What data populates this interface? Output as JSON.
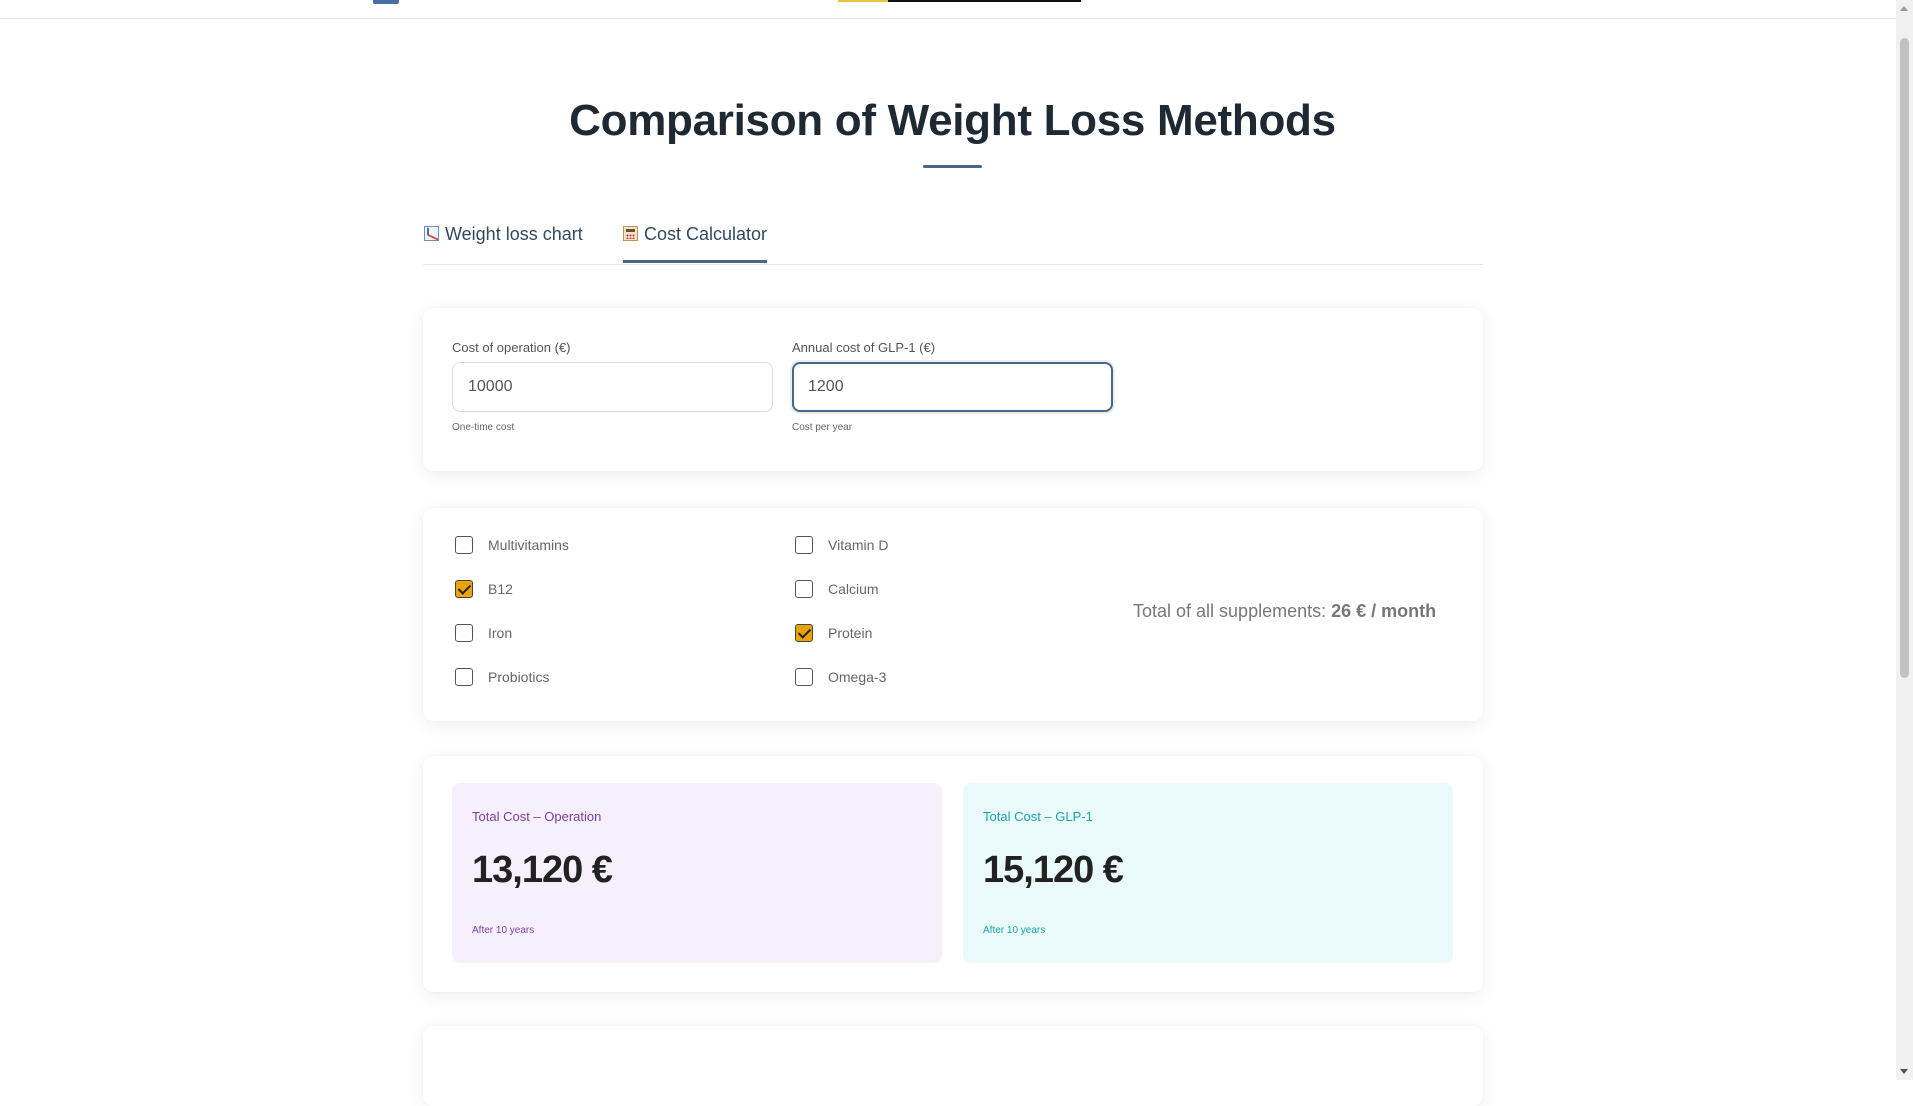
{
  "page": {
    "title": "Comparison of Weight Loss Methods"
  },
  "tabs": [
    {
      "label": "Weight loss chart",
      "icon": "chart-decreasing-icon",
      "active": false
    },
    {
      "label": "Cost Calculator",
      "icon": "abacus-icon",
      "active": true
    }
  ],
  "inputs": {
    "operation": {
      "label": "Cost of operation (€)",
      "value": "10000",
      "hint": "One-time cost"
    },
    "glp1": {
      "label": "Annual cost of GLP-1 (€)",
      "value": "1200",
      "hint": "Cost per year"
    }
  },
  "supplements": {
    "items": [
      {
        "label": "Multivitamins",
        "checked": false
      },
      {
        "label": "B12",
        "checked": true
      },
      {
        "label": "Iron",
        "checked": false
      },
      {
        "label": "Probiotics",
        "checked": false
      },
      {
        "label": "Vitamin D",
        "checked": false
      },
      {
        "label": "Calcium",
        "checked": false
      },
      {
        "label": "Protein",
        "checked": true
      },
      {
        "label": "Omega-3",
        "checked": false
      }
    ],
    "total_label": "Total of all supplements:",
    "total_value": "26 € / month"
  },
  "results": {
    "operation": {
      "label": "Total Cost – Operation",
      "value": "13,120 €",
      "note": "After 10 years"
    },
    "glp1": {
      "label": "Total Cost – GLP-1",
      "value": "15,120 €",
      "note": "After 10 years"
    }
  },
  "colors": {
    "accent": "#4a6782",
    "checkbox_checked": "#e9a400",
    "operation_accent": "#7a3e9d",
    "glp1_accent": "#1aa3ad"
  }
}
